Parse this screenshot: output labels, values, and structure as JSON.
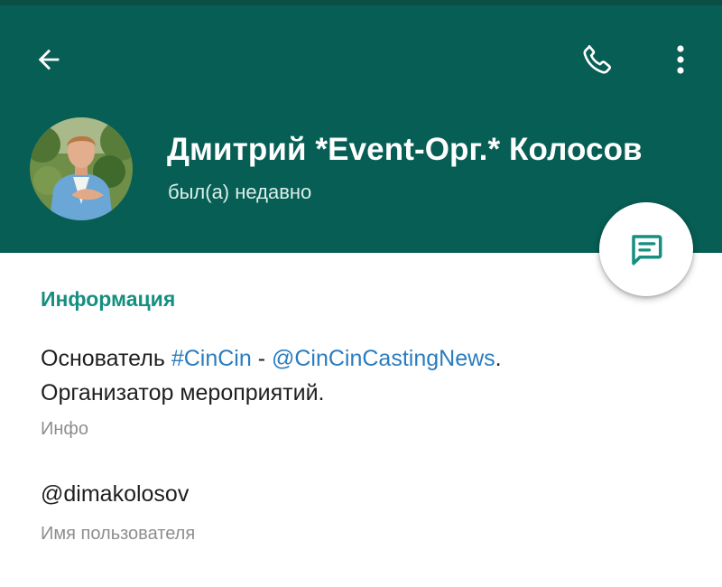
{
  "header": {
    "name": "Дмитрий *Event-Орг.* Колосов",
    "status": "был(а) недавно",
    "back_icon": "arrow-left-icon",
    "call_icon": "phone-icon",
    "menu_icon": "more-vertical-icon",
    "fab_icon": "message-icon"
  },
  "info": {
    "section_title": "Информация",
    "bio": {
      "prefix": "Основатель ",
      "hashtag": "#CinCin",
      "separator": " - ",
      "mention": "@CinCinCastingNews",
      "suffix": ".",
      "line2": "Организатор мероприятий."
    },
    "bio_caption": "Инфо",
    "username": "@dimakolosov",
    "username_caption": "Имя пользователя"
  },
  "colors": {
    "header_bg": "#075e54",
    "accent": "#168f80",
    "link": "#2a7cc0"
  }
}
